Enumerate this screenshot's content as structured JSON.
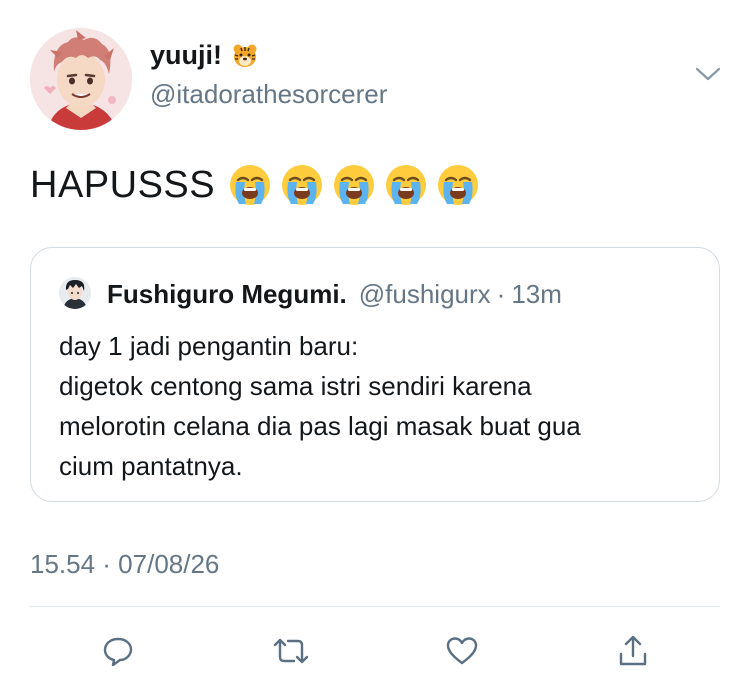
{
  "author": {
    "display_name": "yuuji!",
    "name_emoji": "tiger-face-emoji",
    "handle": "@itadorathesorcerer",
    "avatar": "anime-avatar-pink-hair"
  },
  "tweet": {
    "text": "HAPUSSS",
    "emojis": [
      "loudly-crying-face",
      "loudly-crying-face",
      "loudly-crying-face",
      "loudly-crying-face",
      "loudly-crying-face"
    ],
    "timestamp": "15.54 · 07/08/26"
  },
  "quoted_tweet": {
    "display_name": "Fushiguro Megumi.",
    "handle": "@fushigurx",
    "separator": "·",
    "time": "13m",
    "lines": [
      "day 1 jadi pengantin baru:",
      "digetok centong sama istri sendiri karena",
      "melorotin celana dia pas lagi masak buat gua",
      "cium pantatnya."
    ]
  },
  "actions": [
    "reply-icon",
    "retweet-icon",
    "like-icon",
    "share-icon"
  ],
  "colors": {
    "text": "#14171a",
    "secondary": "#657786",
    "border": "#d3dbe1",
    "divider": "#e1e8ed",
    "icon": "#5b7083"
  }
}
